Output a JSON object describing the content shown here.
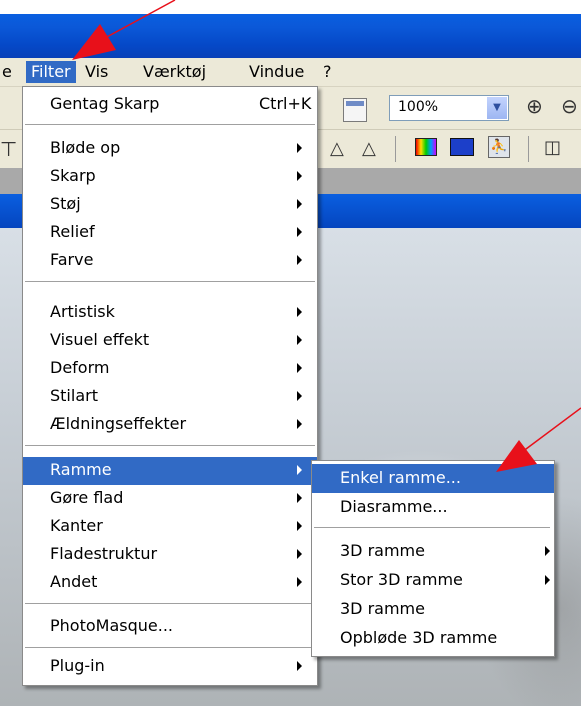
{
  "menubar": {
    "items": [
      {
        "label": "e"
      },
      {
        "label": "Filter"
      },
      {
        "label": "Vis"
      },
      {
        "label": "Værktøj"
      },
      {
        "label": "Vindue"
      },
      {
        "label": "?"
      }
    ]
  },
  "toolbar": {
    "zoom_value": "100%",
    "zoom_in_glyph": "⊕",
    "zoom_out_glyph": "⊖",
    "triangle_glyph": "△",
    "book_glyph": "◫",
    "left_glyph": "⊤",
    "runner_glyph": "⛹"
  },
  "filter_menu": {
    "items": [
      {
        "label": "Gentag Skarp",
        "shortcut": "Ctrl+K"
      },
      {
        "label": "Bløde op"
      },
      {
        "label": "Skarp"
      },
      {
        "label": "Støj"
      },
      {
        "label": "Relief"
      },
      {
        "label": "Farve"
      },
      {
        "label": "Artistisk"
      },
      {
        "label": "Visuel effekt"
      },
      {
        "label": "Deform"
      },
      {
        "label": "Stilart"
      },
      {
        "label": "Ældningseffekter"
      },
      {
        "label": "Ramme",
        "highlighted": true
      },
      {
        "label": "Gøre flad"
      },
      {
        "label": "Kanter"
      },
      {
        "label": "Fladestruktur"
      },
      {
        "label": "Andet"
      },
      {
        "label": "PhotoMasque..."
      },
      {
        "label": "Plug-in"
      }
    ]
  },
  "ramme_submenu": {
    "items": [
      {
        "label": "Enkel ramme...",
        "highlighted": true
      },
      {
        "label": "Diasramme..."
      },
      {
        "label": "3D ramme"
      },
      {
        "label": "Stor 3D ramme"
      },
      {
        "label": "3D ramme"
      },
      {
        "label": "Opbløde 3D ramme"
      }
    ]
  },
  "colors": {
    "highlight": "#316ac5",
    "titlebar": "#0a5fe0",
    "menubar_bg": "#ece9d8",
    "annotation_arrow": "#e8101a"
  }
}
